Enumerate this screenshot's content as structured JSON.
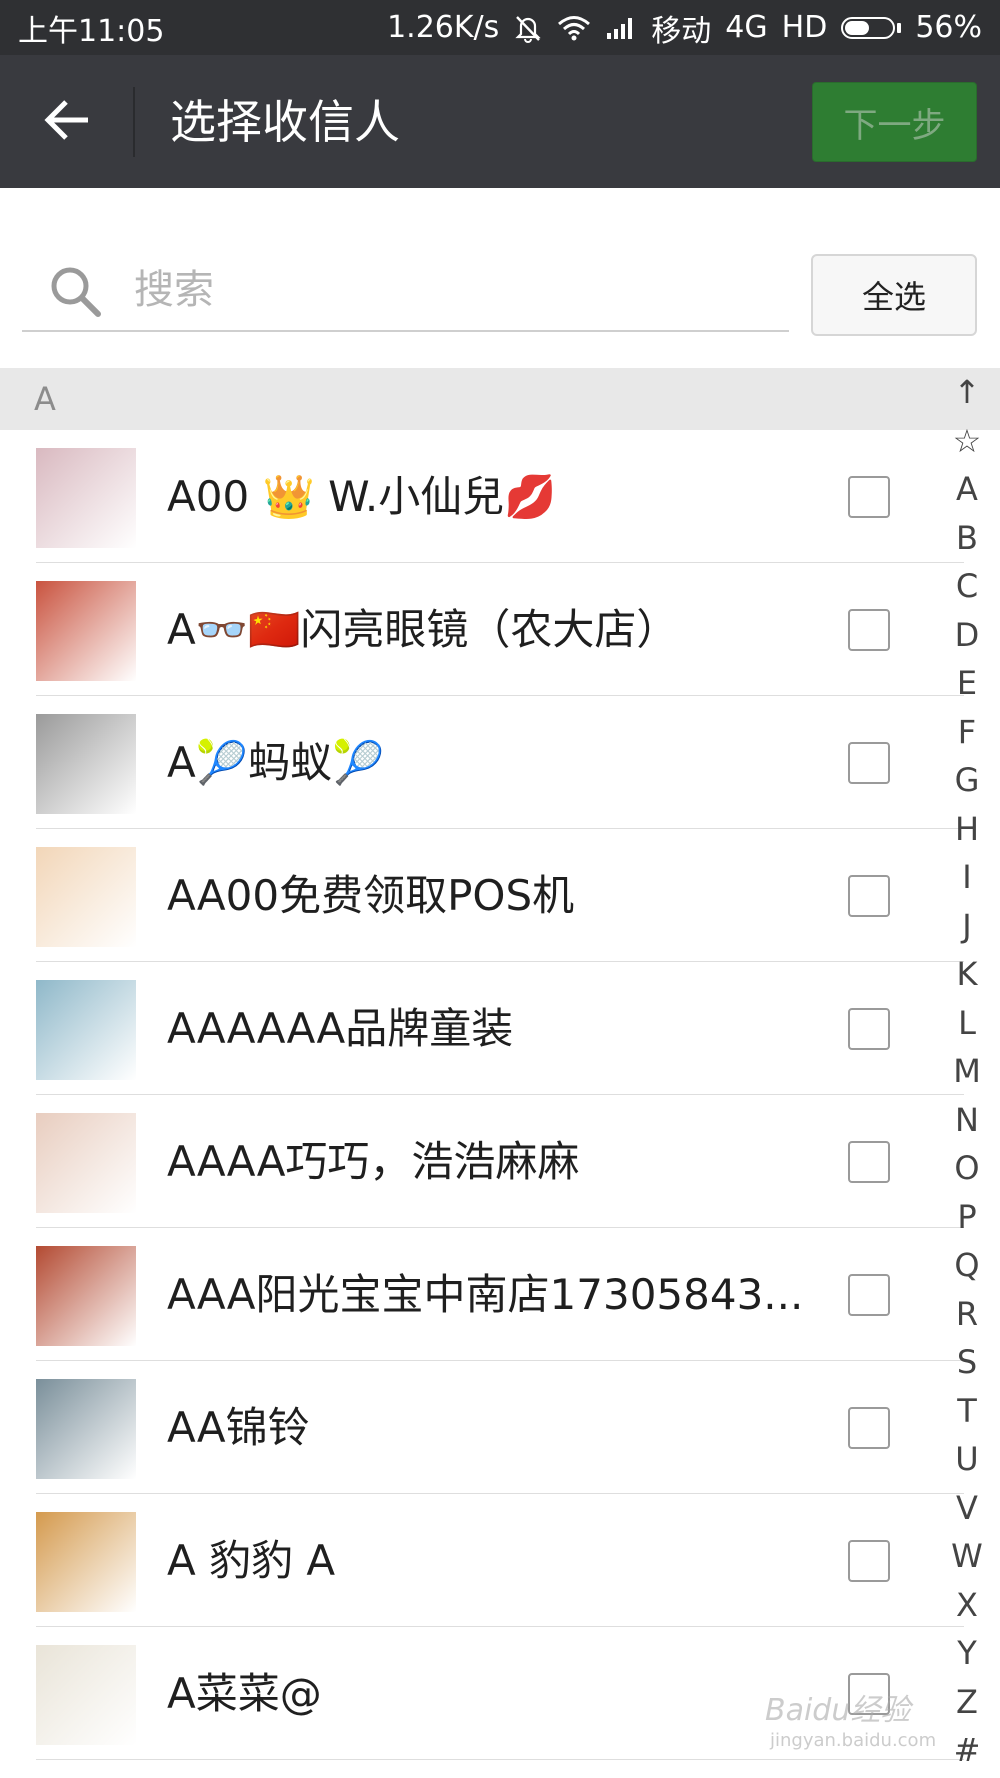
{
  "status_bar": {
    "time": "上午11:05",
    "speed": "1.26K/s",
    "carrier": "移动",
    "network": "4G",
    "hd": "HD",
    "battery_percent": "56%",
    "battery_level": 0.56,
    "icons": [
      "bell-muted-icon",
      "wifi-icon",
      "signal-icon",
      "battery-icon"
    ]
  },
  "header": {
    "title": "选择收信人",
    "next_label": "下一步",
    "back_icon": "arrow-left-icon"
  },
  "search": {
    "placeholder": "搜索",
    "select_all_label": "全选",
    "icon": "search-icon"
  },
  "section": {
    "letter": "A"
  },
  "contacts": [
    {
      "name": "A00 👑 W.小仙兒💋",
      "avatar_color": "#d9b9c0",
      "checked": false
    },
    {
      "name": "A👓🇨🇳闪亮眼镜（农大店）",
      "avatar_color": "#c9533f",
      "checked": false
    },
    {
      "name": "A🎾蚂蚁🎾",
      "avatar_color": "#9a9a9a",
      "checked": false
    },
    {
      "name": "AA00免费领取POS机",
      "avatar_color": "#f2d6b8",
      "checked": false
    },
    {
      "name": "AAAAAA品牌童装",
      "avatar_color": "#8fb8c9",
      "checked": false
    },
    {
      "name": "AAAA巧巧，浩浩麻麻",
      "avatar_color": "#e8cdbf",
      "checked": false
    },
    {
      "name": "AAA阳光宝宝中南店17305843...",
      "avatar_color": "#b34a32",
      "checked": false
    },
    {
      "name": "AA锦铃",
      "avatar_color": "#7a8f9a",
      "checked": false
    },
    {
      "name": "A 豹豹 A",
      "avatar_color": "#d49a4e",
      "checked": false
    },
    {
      "name": "A菜菜@",
      "avatar_color": "#e9e4d8",
      "checked": false
    }
  ],
  "index_bar": [
    "↑",
    "☆",
    "A",
    "B",
    "C",
    "D",
    "E",
    "F",
    "G",
    "H",
    "I",
    "J",
    "K",
    "L",
    "M",
    "N",
    "O",
    "P",
    "Q",
    "R",
    "S",
    "T",
    "U",
    "V",
    "W",
    "X",
    "Y",
    "Z",
    "#"
  ],
  "watermark": {
    "logo": "Baidu经验",
    "url": "jingyan.baidu.com"
  },
  "colors": {
    "status_bar": "#2f3033",
    "title_bar": "#393a3f",
    "next_button": "#2e7d32",
    "section_header": "#e8e8e8"
  }
}
